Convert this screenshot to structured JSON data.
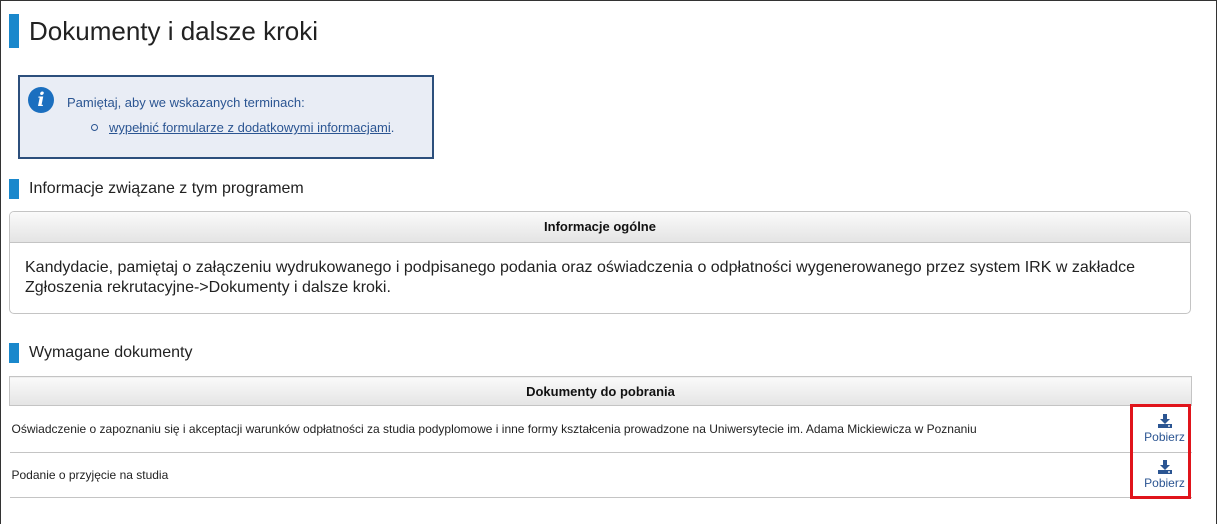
{
  "page": {
    "title": "Dokumenty i dalsze kroki"
  },
  "notice": {
    "icon": "info-icon",
    "text": "Pamiętaj, aby we wskazanych terminach:",
    "link_label": "wypełnić formularze z dodatkowymi informacjami",
    "link_suffix": "."
  },
  "program_info": {
    "section_title": "Informacje związane z tym programem",
    "panel_header": "Informacje ogólne",
    "panel_text": "Kandydacie, pamiętaj o załączeniu wydrukowanego i podpisanego podania oraz oświadczenia o odpłatności wygenerowanego przez system IRK w zakładce Zgłoszenia rekrutacyjne->Dokumenty i dalsze kroki."
  },
  "documents": {
    "section_title": "Wymagane dokumenty",
    "table_header": "Dokumenty do pobrania",
    "rows": [
      {
        "name": "Oświadczenie o zapoznaniu się i akceptacji warunków odpłatności za studia podyplomowe i inne formy kształcenia prowadzone na Uniwersytecie im. Adama Mickiewicza w Poznaniu",
        "action": "Pobierz",
        "icon": "download-icon"
      },
      {
        "name": "Podanie o przyjęcie na studia",
        "action": "Pobierz",
        "icon": "download-icon"
      }
    ]
  },
  "colors": {
    "accent": "#1a88cc",
    "notice_border": "#2c4f7c",
    "notice_bg": "#e9edf5",
    "link": "#2b5592",
    "highlight": "#e0141b"
  }
}
